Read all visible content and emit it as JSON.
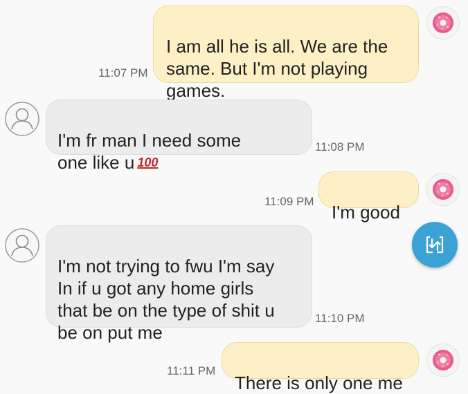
{
  "messages": [
    {
      "direction": "outgoing",
      "text": "I am all he is all. We are the\nsame. But I'm not playing\ngames.",
      "time": "11:07 PM"
    },
    {
      "direction": "incoming",
      "text": "I'm fr man I need some\none like u",
      "emoji": "100",
      "time": "11:08 PM"
    },
    {
      "direction": "outgoing",
      "text": "I'm good",
      "time": "11:09 PM"
    },
    {
      "direction": "incoming",
      "text": "I'm not trying to fwu I'm say\nIn if u got any home girls\nthat be on the type of shit u\nbe on put me",
      "time": "11:10 PM"
    },
    {
      "direction": "outgoing",
      "text": "There is only one me",
      "time": "11:11 PM"
    }
  ],
  "icons": {
    "outgoing_avatar": "donut-avatar-icon",
    "incoming_avatar": "person-outline-icon",
    "fab": "share-transfer-icon"
  },
  "colors": {
    "outgoing_bubble": "#fdf0c6",
    "incoming_bubble": "#ececec",
    "fab": "#3aa2d5",
    "emoji_100": "#c6242a"
  }
}
